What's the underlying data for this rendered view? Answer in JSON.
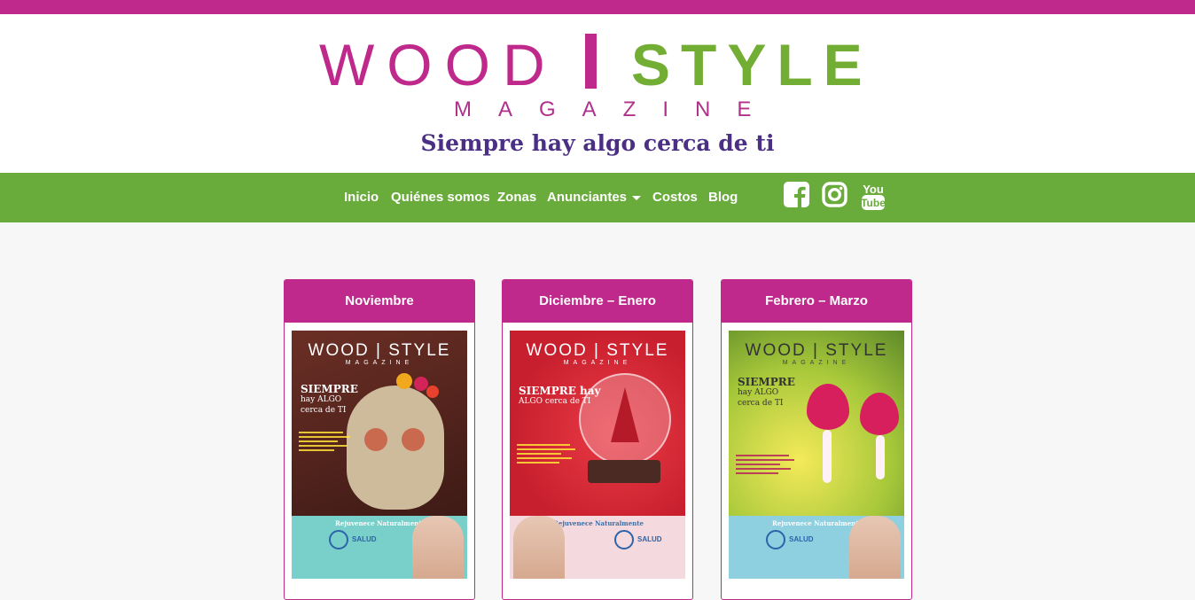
{
  "header": {
    "logo_wood": "WOOD",
    "logo_style": "STYLE",
    "logo_magazine": "MAGAZINE",
    "tagline": "Siempre hay algo cerca de ti"
  },
  "nav": {
    "items": [
      {
        "label": "Inicio"
      },
      {
        "label": "Quiénes somos"
      },
      {
        "label": "Zonas"
      },
      {
        "label": "Anunciantes",
        "dropdown": true
      },
      {
        "label": "Costos"
      },
      {
        "label": "Blog"
      }
    ],
    "social": [
      "facebook-icon",
      "instagram-icon",
      "youtube-icon"
    ]
  },
  "issues": [
    {
      "title": "Noviembre",
      "cover": {
        "masthead": "WOOD | STYLE",
        "magazine": "MAGAZINE",
        "tag_1": "SIEMPRE",
        "tag_2": "hay ALGO",
        "tag_3": "cerca de TI",
        "ad_heading": "Rejuvenece Naturalmente",
        "ad_brand": "SALUD",
        "color": "#5a2a22"
      }
    },
    {
      "title": "Diciembre – Enero",
      "cover": {
        "masthead": "WOOD | STYLE",
        "magazine": "MAGAZINE",
        "tag_1": "SIEMPRE hay",
        "tag_2": "ALGO cerca de TI",
        "tag_3": "",
        "ad_heading": "Rejuvenece Naturalmente",
        "ad_brand": "SALUD",
        "color": "#d42a3a"
      }
    },
    {
      "title": "Febrero – Marzo",
      "cover": {
        "masthead": "WOOD | STYLE",
        "magazine": "MAGAZINE",
        "tag_1": "SIEMPRE",
        "tag_2": "hay ALGO",
        "tag_3": "cerca de TI",
        "ad_heading": "Rejuvenece Naturalmente",
        "ad_brand": "SALUD",
        "color": "#9dc23a"
      }
    }
  ],
  "colors": {
    "magenta": "#c0298c",
    "green": "#6aac3b",
    "purple": "#4a2f85"
  }
}
